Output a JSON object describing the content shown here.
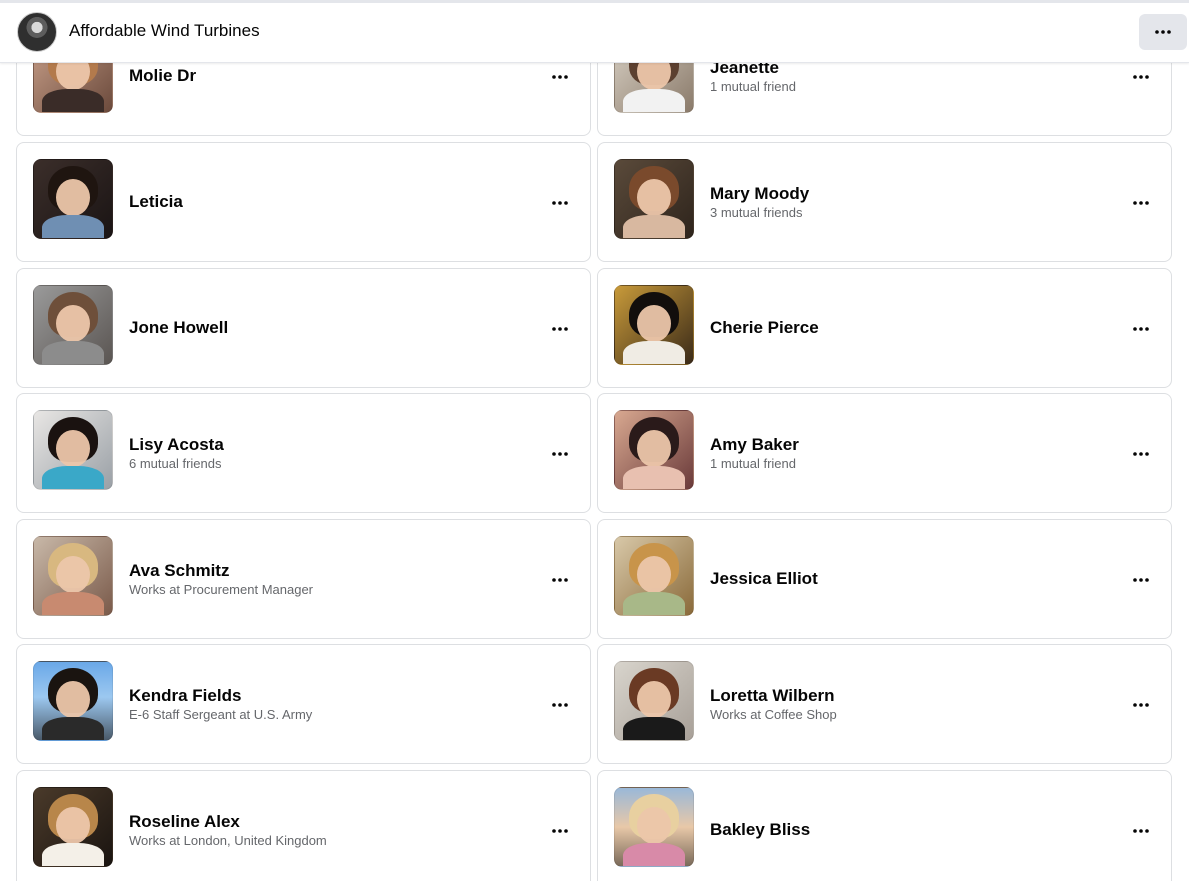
{
  "header": {
    "title": "Affordable Wind Turbines",
    "more_icon": "more-horizontal-icon"
  },
  "friends": [
    {
      "name": "Molie Dr",
      "subtitle": ""
    },
    {
      "name": "Jeanette",
      "subtitle": "1 mutual friend"
    },
    {
      "name": "Leticia",
      "subtitle": ""
    },
    {
      "name": "Mary Moody",
      "subtitle": "3 mutual friends"
    },
    {
      "name": "Jone Howell",
      "subtitle": ""
    },
    {
      "name": "Cherie Pierce",
      "subtitle": ""
    },
    {
      "name": "Lisy Acosta",
      "subtitle": "6 mutual friends"
    },
    {
      "name": "Amy Baker",
      "subtitle": "1 mutual friend"
    },
    {
      "name": "Ava Schmitz",
      "subtitle": "Works at Procurement Manager"
    },
    {
      "name": "Jessica Elliot",
      "subtitle": ""
    },
    {
      "name": "Kendra Fields",
      "subtitle": "E-6 Staff Sergeant at U.S. Army"
    },
    {
      "name": "Loretta Wilbern",
      "subtitle": "Works at Coffee Shop"
    },
    {
      "name": "Roseline Alex",
      "subtitle": "Works at London, United Kingdom"
    },
    {
      "name": "Bakley Bliss",
      "subtitle": ""
    }
  ],
  "colors": {
    "card_border": "#dddfe2",
    "subtitle": "#65676b",
    "button_bg": "#e4e6eb"
  }
}
